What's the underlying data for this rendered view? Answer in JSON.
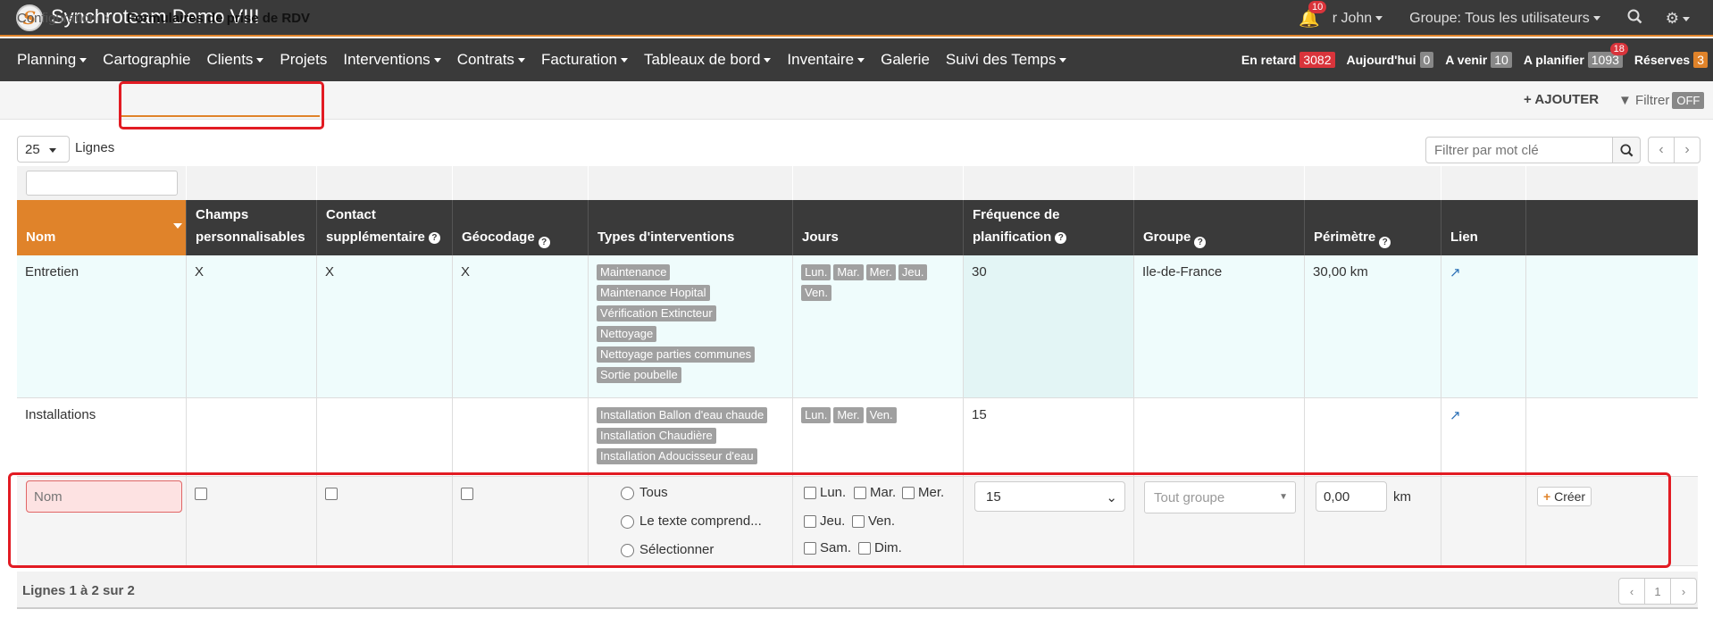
{
  "app": {
    "logo_letter": "S",
    "title": "Synchroteam Demo VIII",
    "notifications_count": "10",
    "user_label": "r John",
    "group_label": "Groupe: Tous les utilisateurs"
  },
  "nav": {
    "items": [
      "Planning",
      "Cartographie",
      "Clients",
      "Projets",
      "Interventions",
      "Contrats",
      "Facturation",
      "Tableaux de bord",
      "Inventaire",
      "Galerie",
      "Suivi des Temps"
    ],
    "stats": [
      {
        "label": "En retard",
        "value": "3082",
        "color": "#d9343b"
      },
      {
        "label": "Aujourd'hui",
        "value": "0",
        "color": "#888888"
      },
      {
        "label": "A venir",
        "value": "10",
        "color": "#888888"
      },
      {
        "label": "A planifier",
        "value": "1093",
        "color": "#888888",
        "badge": "18"
      },
      {
        "label": "Réserves",
        "value": "3",
        "color": "#e0832a"
      }
    ]
  },
  "breadcrumb": {
    "parent": "Configuration",
    "current": "Formulaires de prise de RDV"
  },
  "actions": {
    "add_label": "AJOUTER",
    "filter_label": "Filtrer",
    "filter_state": "OFF"
  },
  "controls": {
    "rows_value": "25",
    "rows_label": "Lignes",
    "keyword_placeholder": "Filtrer par mot clé"
  },
  "table": {
    "headers": [
      {
        "l1": "",
        "l2": "Nom"
      },
      {
        "l1": "Champs",
        "l2": "personnalisables"
      },
      {
        "l1": "Contact",
        "l2": "supplémentaire"
      },
      {
        "l1": "",
        "l2": "Géocodage"
      },
      {
        "l1": "",
        "l2": "Types d'interventions"
      },
      {
        "l1": "",
        "l2": "Jours"
      },
      {
        "l1": "Fréquence de",
        "l2": "planification"
      },
      {
        "l1": "",
        "l2": "Groupe"
      },
      {
        "l1": "",
        "l2": "Périmètre"
      },
      {
        "l1": "",
        "l2": "Lien"
      }
    ],
    "rows": [
      {
        "nom": "Entretien",
        "champs": "X",
        "contact": "X",
        "geocodage": "X",
        "types": [
          "Maintenance",
          "Maintenance Hopital",
          "Vérification Extincteur",
          "Nettoyage",
          "Nettoyage parties communes",
          "Sortie poubelle"
        ],
        "jours": [
          "Lun.",
          "Mar.",
          "Mer.",
          "Jeu.",
          "Ven."
        ],
        "frequence": "30",
        "groupe": "Ile-de-France",
        "perimetre": "30,00 km"
      },
      {
        "nom": "Installations",
        "champs": "",
        "contact": "",
        "geocodage": "",
        "types": [
          "Installation Ballon d'eau chaude",
          "Installation Chaudière",
          "Installation Adoucisseur d'eau"
        ],
        "jours": [
          "Lun.",
          "Mer.",
          "Ven."
        ],
        "frequence": "15",
        "groupe": "",
        "perimetre": ""
      }
    ],
    "new_row": {
      "nom_placeholder": "Nom",
      "type_options": [
        "Tous",
        "Le texte comprend...",
        "Sélectionner"
      ],
      "days": [
        "Lun.",
        "Mar.",
        "Mer.",
        "Jeu.",
        "Ven.",
        "Sam.",
        "Dim."
      ],
      "frequence_value": "15",
      "groupe_placeholder": "Tout groupe",
      "perimetre_value": "0,00",
      "perimetre_unit": "km",
      "create_label": "Créer"
    }
  },
  "footer": {
    "summary": "Lignes 1 à 2 sur 2",
    "page": "1"
  }
}
